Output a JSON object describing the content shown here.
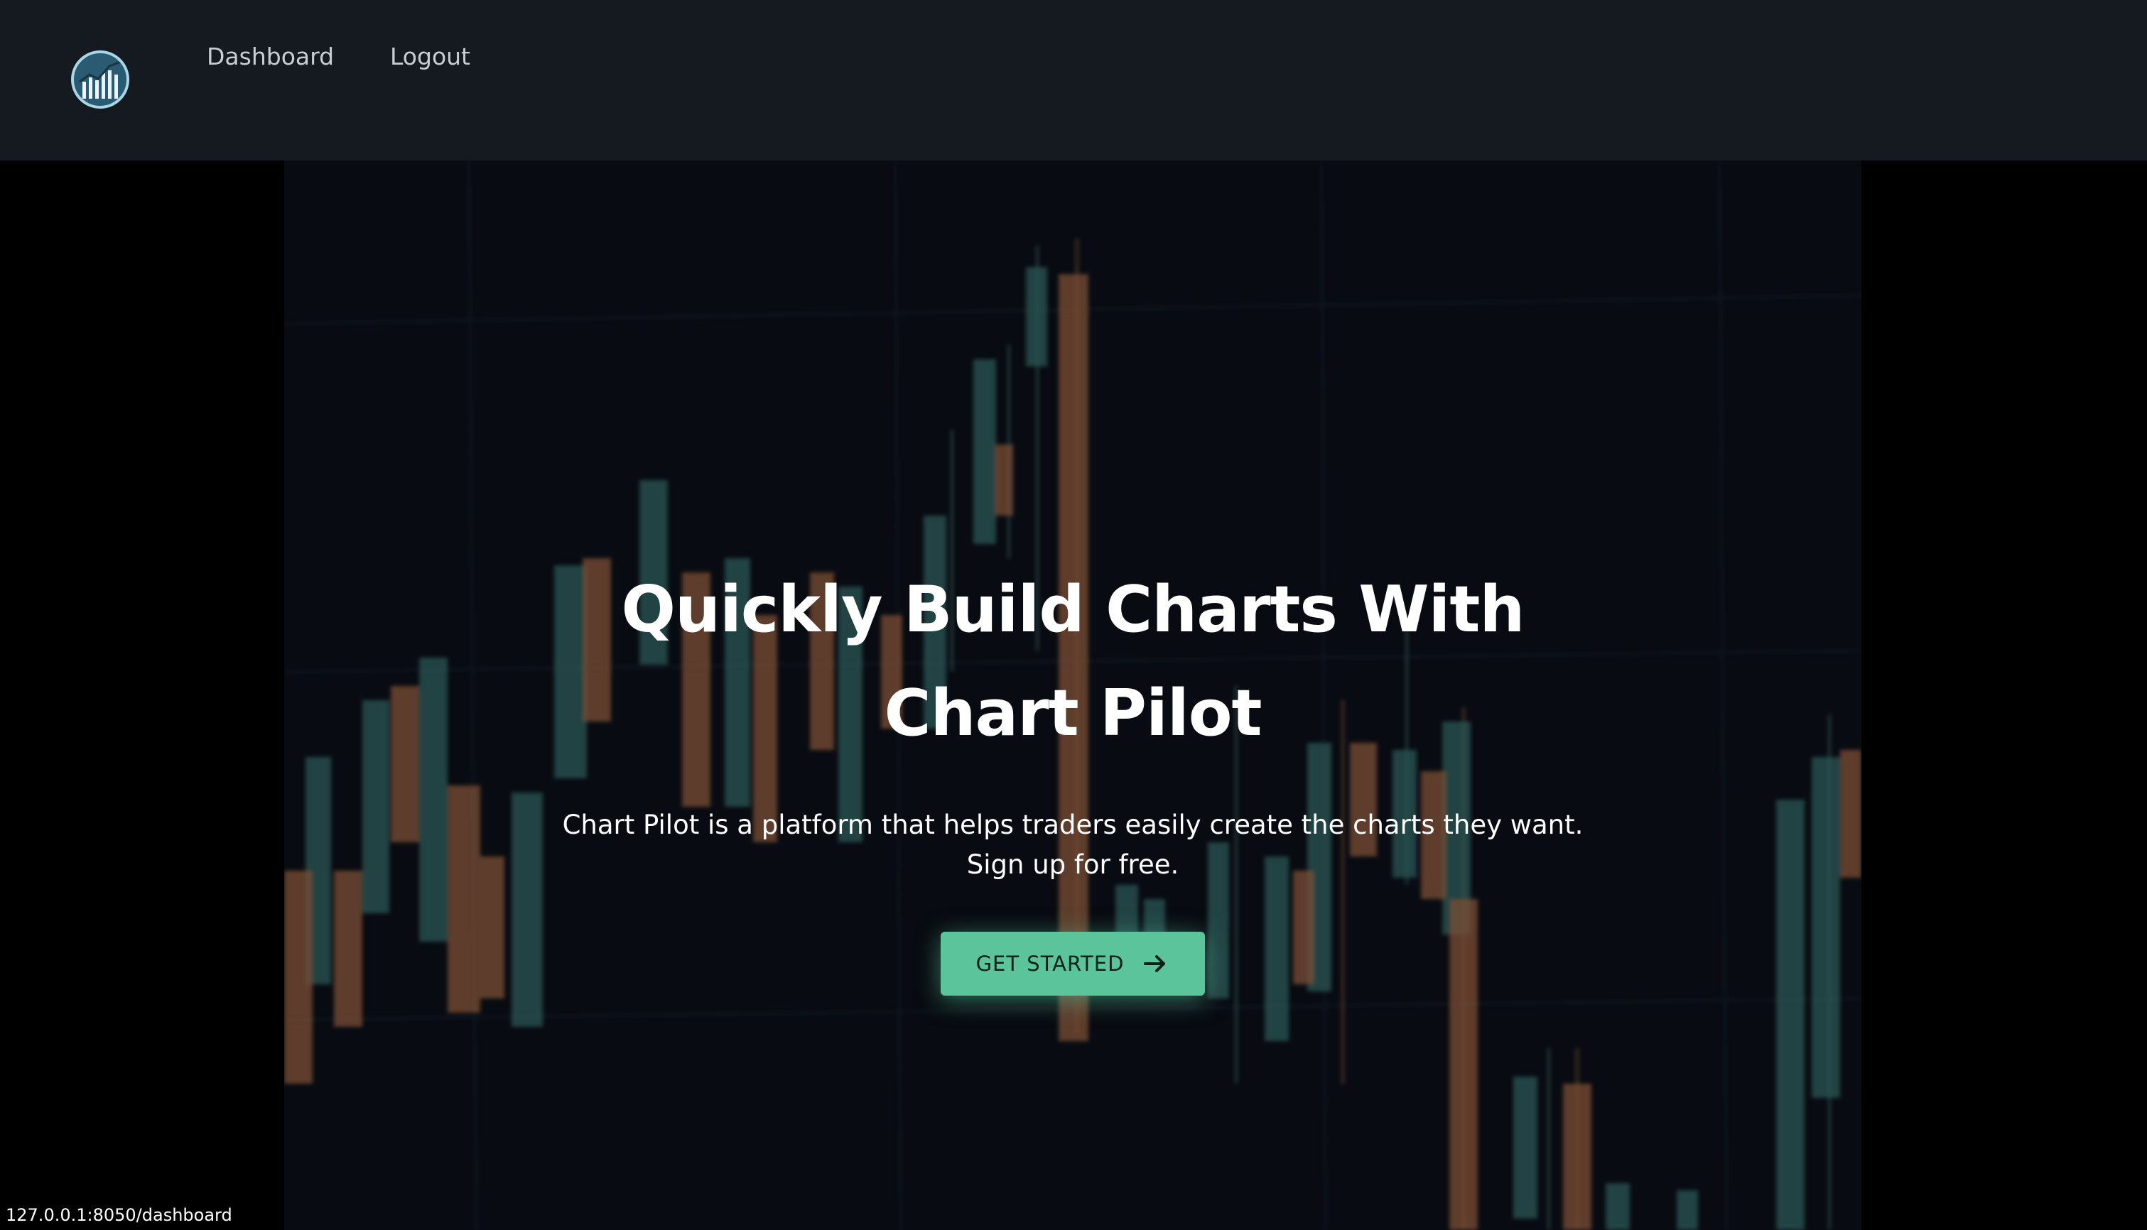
{
  "nav": {
    "logo_name": "chart-pilot-logo",
    "links": [
      {
        "label": "Dashboard"
      },
      {
        "label": "Logout"
      }
    ]
  },
  "hero": {
    "title_line1": "Quickly Build Charts With",
    "title_line2": "Chart Pilot",
    "subtitle_line1": "Chart Pilot is a platform that helps traders easily create the charts they want.",
    "subtitle_line2": "Sign up for free.",
    "cta_label": "GET STARTED",
    "cta_icon": "arrow-right-icon",
    "background": "blurred-candlestick-chart-image"
  },
  "status_bar": {
    "url": "127.0.0.1:8050/dashboard"
  },
  "colors": {
    "navbar": "#141a1f",
    "page": "#000000",
    "hero_bg": "#080c12",
    "accent": "#5cc49b",
    "candle_up": "#3f7f7a",
    "candle_down": "#b8724a"
  }
}
